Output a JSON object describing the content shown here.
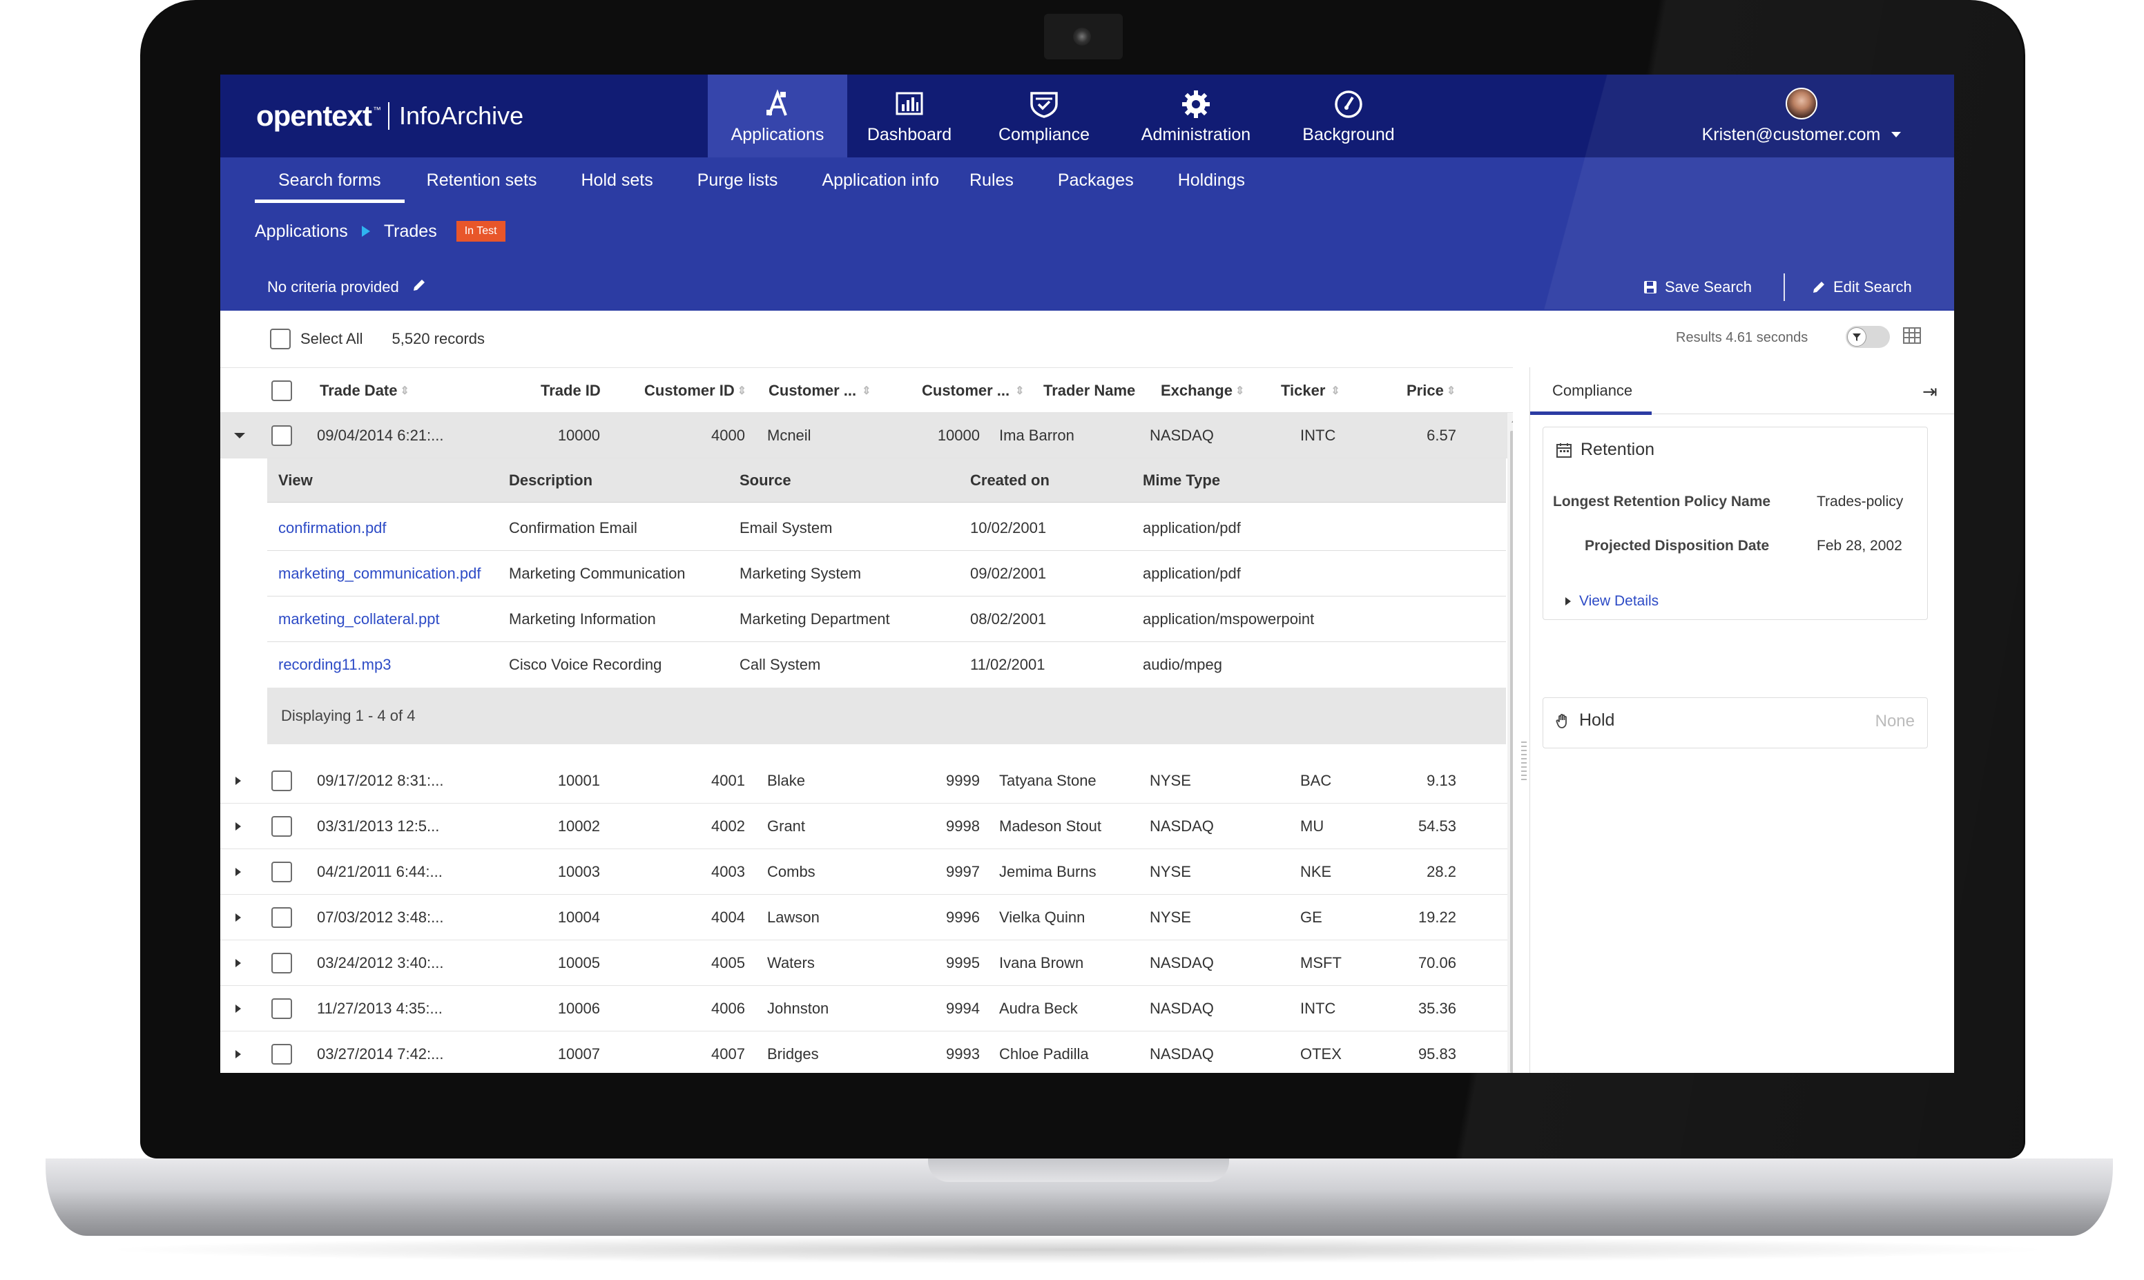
{
  "app": {
    "brand_logo": "opentext",
    "brand_tm": "™",
    "brand_product": "InfoArchive"
  },
  "main_nav": [
    {
      "label": "Applications",
      "icon": "applications-icon"
    },
    {
      "label": "Dashboard",
      "icon": "dashboard-icon"
    },
    {
      "label": "Compliance",
      "icon": "compliance-shield-icon"
    },
    {
      "label": "Administration",
      "icon": "gear-icon"
    },
    {
      "label": "Background",
      "icon": "background-gauge-icon"
    }
  ],
  "user": {
    "email": "Kristen@customer.com"
  },
  "sub_nav": [
    "Search forms",
    "Retention sets",
    "Hold sets",
    "Purge lists",
    "Application info",
    "Rules",
    "Packages",
    "Holdings"
  ],
  "breadcrumb": {
    "root": "Applications",
    "current": "Trades",
    "badge": "In Test"
  },
  "criteria": {
    "text": "No criteria provided"
  },
  "actions": {
    "save": "Save Search",
    "edit": "Edit Search"
  },
  "toolbar": {
    "select_all": "Select All",
    "records": "5,520 records",
    "results": "Results  4.61 seconds"
  },
  "columns": [
    "Trade Date",
    "Trade ID",
    "Customer ID",
    "Customer ...",
    "Customer ...",
    "Trader Name",
    "Exchange",
    "Ticker",
    "Price"
  ],
  "rows": [
    {
      "date": "09/04/2014 6:21:...",
      "trade_id": "10000",
      "cust_id": "4000",
      "cust_name": "Mcneil",
      "cust_num": "10000",
      "trader": "Ima Barron",
      "exchange": "NASDAQ",
      "ticker": "INTC",
      "price": "6.57"
    },
    {
      "date": "09/17/2012 8:31:...",
      "trade_id": "10001",
      "cust_id": "4001",
      "cust_name": "Blake",
      "cust_num": "9999",
      "trader": "Tatyana Stone",
      "exchange": "NYSE",
      "ticker": "BAC",
      "price": "9.13"
    },
    {
      "date": "03/31/2013 12:5...",
      "trade_id": "10002",
      "cust_id": "4002",
      "cust_name": "Grant",
      "cust_num": "9998",
      "trader": "Madeson Stout",
      "exchange": "NASDAQ",
      "ticker": "MU",
      "price": "54.53"
    },
    {
      "date": "04/21/2011 6:44:...",
      "trade_id": "10003",
      "cust_id": "4003",
      "cust_name": "Combs",
      "cust_num": "9997",
      "trader": "Jemima Burns",
      "exchange": "NYSE",
      "ticker": "NKE",
      "price": "28.2"
    },
    {
      "date": "07/03/2012 3:48:...",
      "trade_id": "10004",
      "cust_id": "4004",
      "cust_name": "Lawson",
      "cust_num": "9996",
      "trader": "Vielka Quinn",
      "exchange": "NYSE",
      "ticker": "GE",
      "price": "19.22"
    },
    {
      "date": "03/24/2012 3:40:...",
      "trade_id": "10005",
      "cust_id": "4005",
      "cust_name": "Waters",
      "cust_num": "9995",
      "trader": "Ivana Brown",
      "exchange": "NASDAQ",
      "ticker": "MSFT",
      "price": "70.06"
    },
    {
      "date": "11/27/2013 4:35:...",
      "trade_id": "10006",
      "cust_id": "4006",
      "cust_name": "Johnston",
      "cust_num": "9994",
      "trader": "Audra Beck",
      "exchange": "NASDAQ",
      "ticker": "INTC",
      "price": "35.36"
    },
    {
      "date": "03/27/2014 7:42:...",
      "trade_id": "10007",
      "cust_id": "4007",
      "cust_name": "Bridges",
      "cust_num": "9993",
      "trader": "Chloe Padilla",
      "exchange": "NASDAQ",
      "ticker": "OTEX",
      "price": "95.83"
    }
  ],
  "detail": {
    "columns": [
      "View",
      "Description",
      "Source",
      "Created on",
      "Mime Type"
    ],
    "rows": [
      {
        "view": "confirmation.pdf",
        "description": "Confirmation Email",
        "source": "Email System",
        "created": "10/02/2001",
        "mime": "application/pdf"
      },
      {
        "view": "marketing_communication.pdf",
        "description": "Marketing Communication",
        "source": "Marketing System",
        "created": "09/02/2001",
        "mime": "application/pdf"
      },
      {
        "view": "marketing_collateral.ppt",
        "description": "Marketing Information",
        "source": "Marketing Department",
        "created": "08/02/2001",
        "mime": "application/mspowerpoint"
      },
      {
        "view": "recording11.mp3",
        "description": "Cisco Voice Recording",
        "source": "Call System",
        "created": "11/02/2001",
        "mime": "audio/mpeg"
      }
    ],
    "footer": "Displaying 1 - 4 of 4"
  },
  "panel": {
    "tab": "Compliance",
    "collapse": "⇥",
    "retention": {
      "title": "Retention",
      "policy_label": "Longest Retention Policy Name",
      "policy_value": "Trades-policy",
      "disposition_label": "Projected Disposition Date",
      "disposition_value": "Feb 28, 2002",
      "view_details": "View Details"
    },
    "hold": {
      "title": "Hold",
      "value": "None"
    }
  },
  "colors": {
    "header": "#111c74",
    "subheader": "#2c3ca3",
    "active_nav": "#3645ab",
    "badge": "#e8562a",
    "link": "#2d4bc6"
  }
}
